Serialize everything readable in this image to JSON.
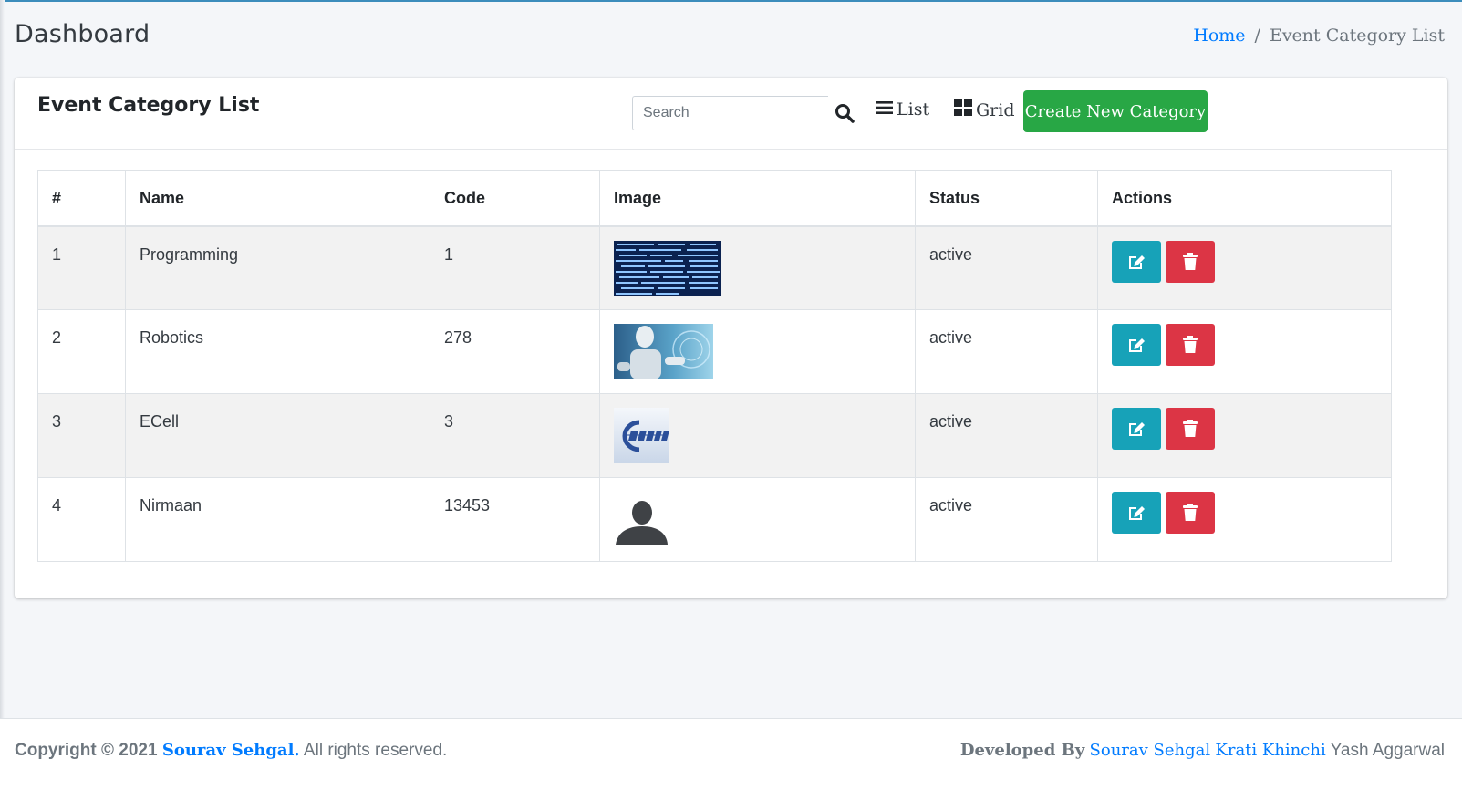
{
  "header": {
    "page_title": "Dashboard",
    "breadcrumb": {
      "home": "Home",
      "separator": "/",
      "current": "Event Category List"
    }
  },
  "card": {
    "title": "Event Category List",
    "search_placeholder": "Search",
    "list_label": "List",
    "grid_label": "Grid",
    "create_label": "Create New Category"
  },
  "table": {
    "columns": [
      "#",
      "Name",
      "Code",
      "Image",
      "Status",
      "Actions"
    ],
    "rows": [
      {
        "index": "1",
        "name": "Programming",
        "code": "1",
        "image": "code-screen-thumbnail",
        "status": "active"
      },
      {
        "index": "2",
        "name": "Robotics",
        "code": "278",
        "image": "robot-thumbnail",
        "status": "active"
      },
      {
        "index": "3",
        "name": "ECell",
        "code": "3",
        "image": "ecell-logo-thumbnail",
        "status": "active"
      },
      {
        "index": "4",
        "name": "Nirmaan",
        "code": "13453",
        "image": "default-avatar-thumbnail",
        "status": "active"
      }
    ]
  },
  "footer": {
    "copyright_prefix": "Copyright © 2021",
    "owner": "Sourav Sehgal.",
    "rights": "All rights reserved.",
    "developed_by": "Developed By",
    "dev1": "Sourav Sehgal",
    "dev2": "Krati Khinchi",
    "dev3": "Yash Aggarwal"
  },
  "colors": {
    "primary": "#007bff",
    "success": "#28a745",
    "info": "#17a2b8",
    "danger": "#dc3545"
  },
  "icons": [
    "search-icon",
    "list-icon",
    "grid-icon",
    "edit-icon",
    "trash-icon"
  ]
}
